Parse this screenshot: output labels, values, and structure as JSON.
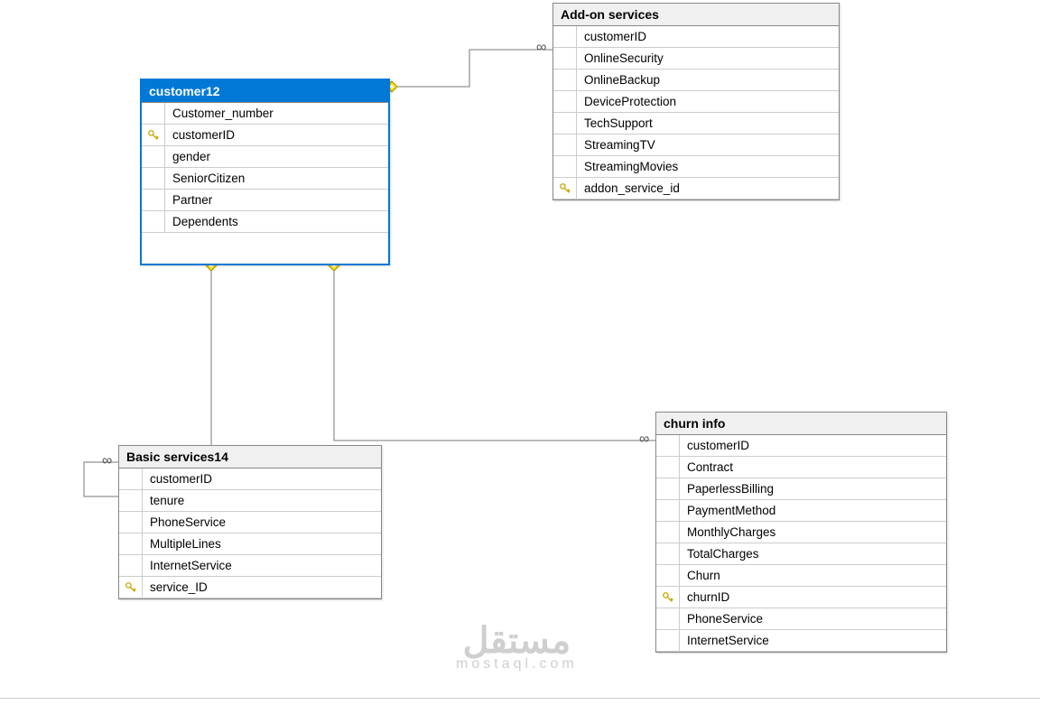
{
  "watermark": {
    "text_ar": "مستقل",
    "text_en": "mostaql.com"
  },
  "entities": {
    "customer12": {
      "title": "customer12",
      "selected": true,
      "fields": [
        {
          "name": "Customer_number",
          "key": false
        },
        {
          "name": "customerID",
          "key": true
        },
        {
          "name": "gender",
          "key": false
        },
        {
          "name": "SeniorCitizen",
          "key": false
        },
        {
          "name": "Partner",
          "key": false
        },
        {
          "name": "Dependents",
          "key": false
        }
      ]
    },
    "addon": {
      "title": "Add-on services",
      "selected": false,
      "fields": [
        {
          "name": "customerID",
          "key": false
        },
        {
          "name": "OnlineSecurity",
          "key": false
        },
        {
          "name": "OnlineBackup",
          "key": false
        },
        {
          "name": "DeviceProtection",
          "key": false
        },
        {
          "name": "TechSupport",
          "key": false
        },
        {
          "name": "StreamingTV",
          "key": false
        },
        {
          "name": "StreamingMovies",
          "key": false
        },
        {
          "name": "addon_service_id",
          "key": true
        }
      ]
    },
    "basic": {
      "title": "Basic services14",
      "selected": false,
      "fields": [
        {
          "name": "customerID",
          "key": false
        },
        {
          "name": "tenure",
          "key": false
        },
        {
          "name": "PhoneService",
          "key": false
        },
        {
          "name": "MultipleLines",
          "key": false
        },
        {
          "name": "InternetService",
          "key": false
        },
        {
          "name": "service_ID",
          "key": true
        }
      ]
    },
    "churn": {
      "title": "churn info",
      "selected": false,
      "fields": [
        {
          "name": "customerID",
          "key": false
        },
        {
          "name": "Contract",
          "key": false
        },
        {
          "name": "PaperlessBilling",
          "key": false
        },
        {
          "name": "PaymentMethod",
          "key": false
        },
        {
          "name": "MonthlyCharges",
          "key": false
        },
        {
          "name": "TotalCharges",
          "key": false
        },
        {
          "name": "Churn",
          "key": false
        },
        {
          "name": "churnID",
          "key": true
        },
        {
          "name": "PhoneService",
          "key": false
        },
        {
          "name": "InternetService",
          "key": false
        }
      ]
    }
  }
}
